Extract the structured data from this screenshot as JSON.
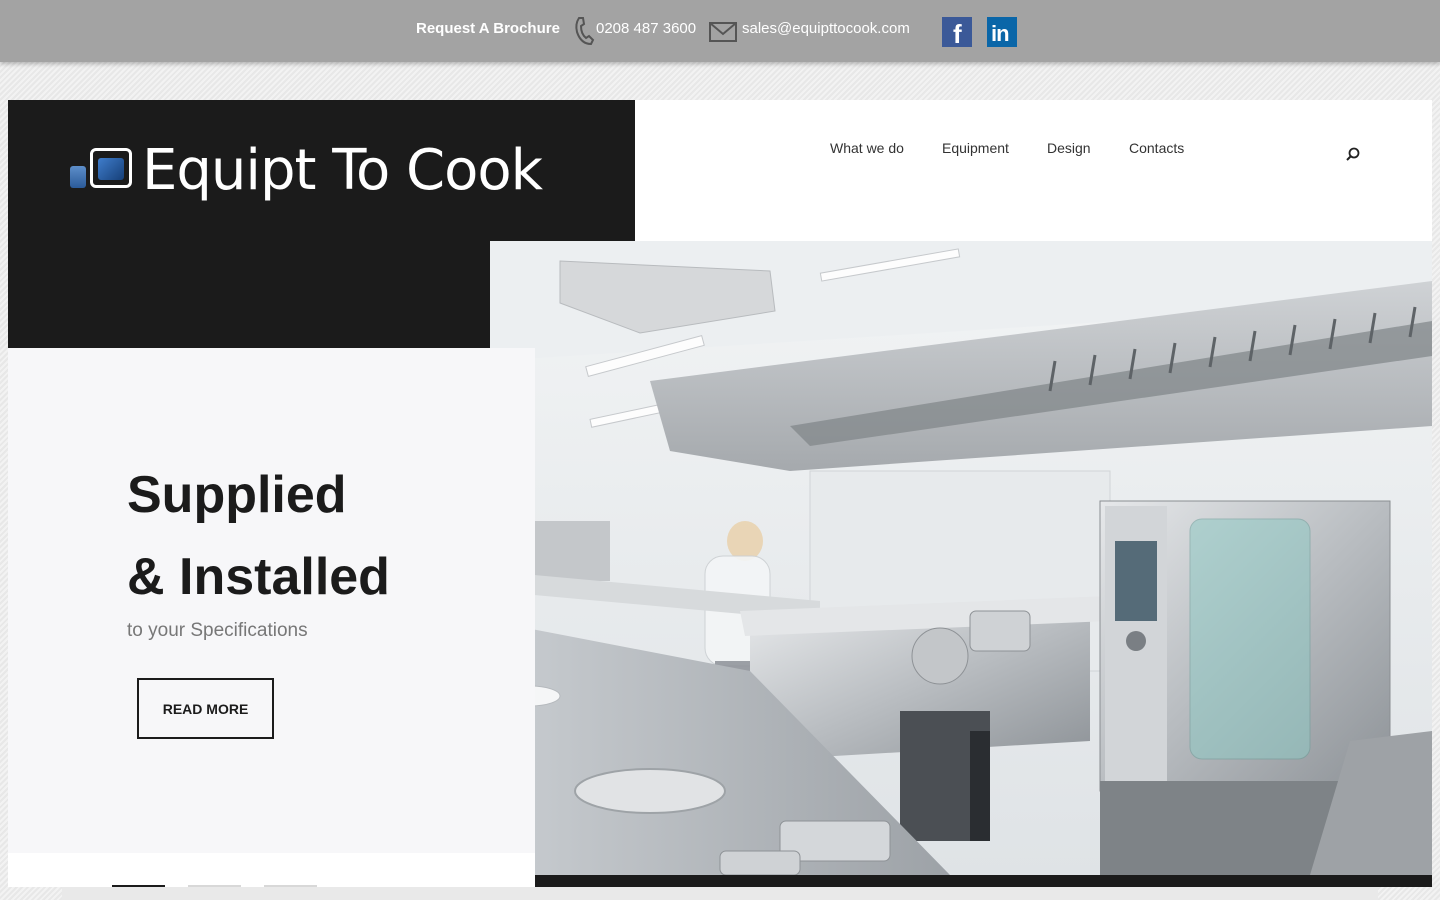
{
  "topbar": {
    "brochure_label": "Request A Brochure",
    "phone": "0208 487 3600",
    "email": "sales@equipttocook.com",
    "social": [
      "facebook-icon",
      "linkedin-icon"
    ]
  },
  "logo": {
    "text": "Equipt To Cook"
  },
  "nav": {
    "items": [
      "What we do",
      "Equipment",
      "Design",
      "Contacts"
    ]
  },
  "hero": {
    "title_line1": "Supplied",
    "title_line2": "& Installed",
    "subtitle": "to your Specifications",
    "button_label": "READ MORE",
    "slides": 3,
    "active_slide": 1
  },
  "colors": {
    "topbar_bg": "#a3a3a3",
    "dark": "#1b1b1b",
    "facebook": "#3b5998",
    "linkedin": "#0a66a8"
  }
}
